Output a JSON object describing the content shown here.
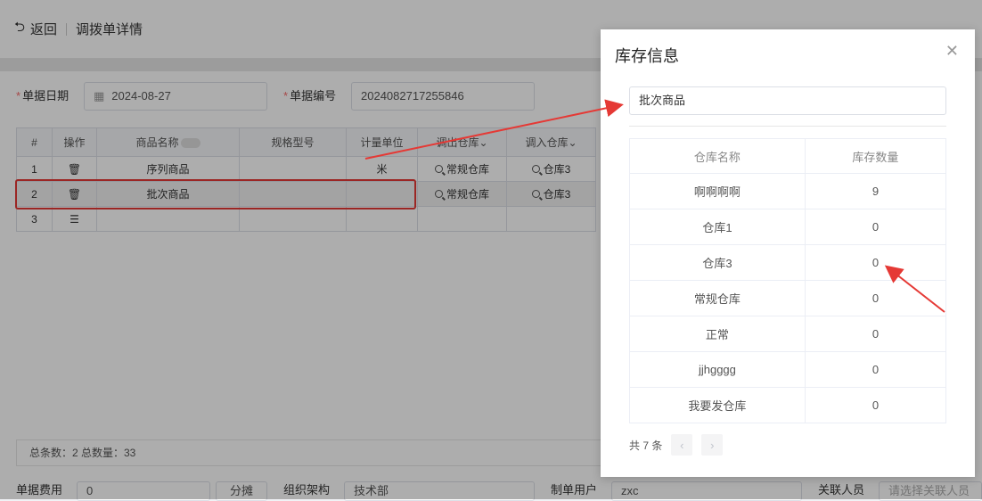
{
  "header": {
    "back_label": "返回",
    "title": "调拨单详情"
  },
  "form": {
    "date_label": "单据日期",
    "date_value": "2024-08-27",
    "number_label": "单据编号",
    "number_value": "2024082717255846"
  },
  "grid": {
    "headers": [
      "#",
      "操作",
      "商品名称",
      "规格型号",
      "计量单位",
      "调出仓库",
      "调入仓库"
    ],
    "rows": [
      {
        "index": "1",
        "name": "序列商品",
        "spec": "",
        "unit": "米",
        "out_wh": "常规仓库",
        "in_wh": "仓库3"
      },
      {
        "index": "2",
        "name": "批次商品",
        "spec": "",
        "unit": "",
        "out_wh": "常规仓库",
        "in_wh": "仓库3"
      },
      {
        "index": "3",
        "name": "",
        "spec": "",
        "unit": "",
        "out_wh": "",
        "in_wh": ""
      }
    ]
  },
  "summary": {
    "text": "总条数：2   总数量：33"
  },
  "bottom": {
    "fee_label": "单据费用",
    "fee_value": "0",
    "split_label": "分摊",
    "org_label": "组织架构",
    "org_value": "技术部",
    "creator_label": "制单用户",
    "creator_value": "zxc",
    "related_label": "关联人员",
    "related_placeholder": "请选择关联人员"
  },
  "modal": {
    "title": "库存信息",
    "search_value": "批次商品",
    "col_name": "仓库名称",
    "col_qty": "库存数量",
    "rows": [
      {
        "name": "啊啊啊啊",
        "qty": "9"
      },
      {
        "name": "仓库1",
        "qty": "0"
      },
      {
        "name": "仓库3",
        "qty": "0"
      },
      {
        "name": "常规仓库",
        "qty": "0"
      },
      {
        "name": "正常",
        "qty": "0"
      },
      {
        "name": "jjhgggg",
        "qty": "0"
      },
      {
        "name": "我要发仓库",
        "qty": "0"
      }
    ],
    "total_text": "共 7 条"
  },
  "colors": {
    "required": "#f56c6c",
    "annotation": "#e53935"
  }
}
